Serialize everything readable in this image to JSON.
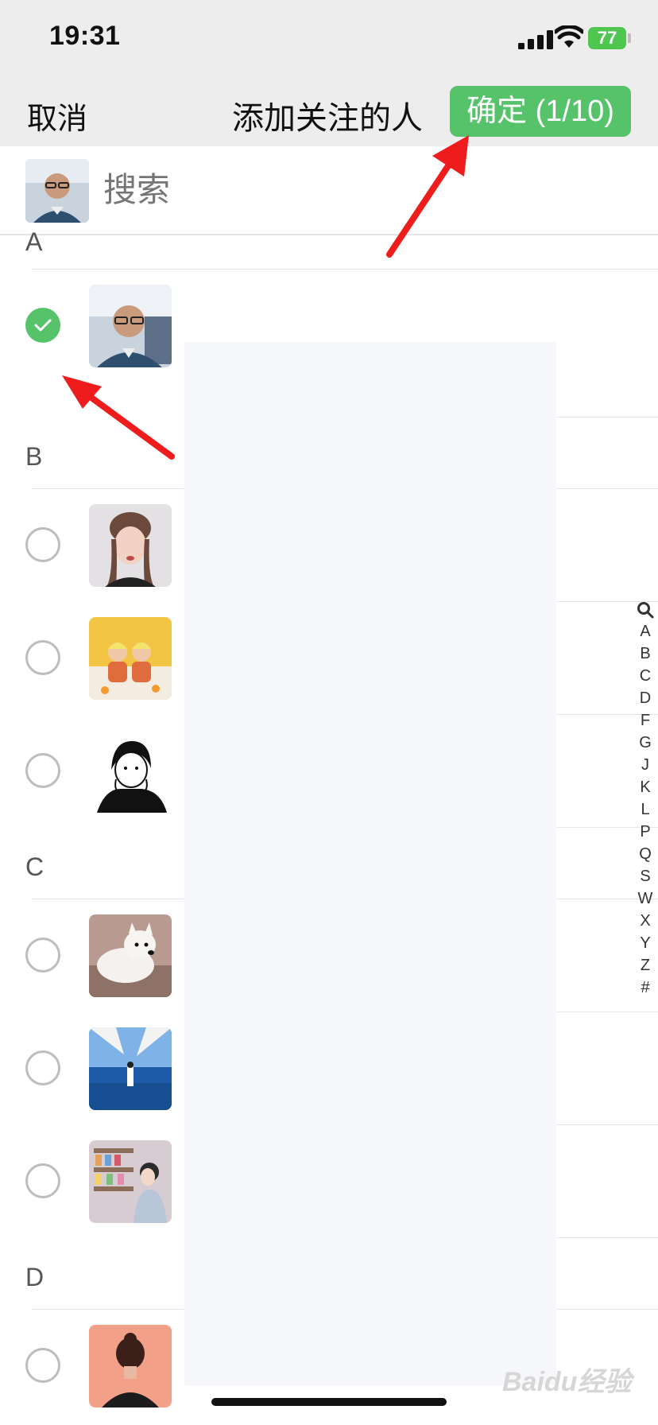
{
  "status_bar": {
    "time": "19:31",
    "battery": "77"
  },
  "nav": {
    "cancel_label": "取消",
    "title": "添加关注的人",
    "confirm_label": "确定 (1/10)"
  },
  "search": {
    "placeholder": "搜索"
  },
  "sections": [
    {
      "letter": "A",
      "items": [
        {
          "checked": true
        }
      ]
    },
    {
      "letter": "B",
      "items": [
        {
          "checked": false
        },
        {
          "checked": false
        },
        {
          "checked": false
        }
      ]
    },
    {
      "letter": "C",
      "items": [
        {
          "checked": false
        },
        {
          "checked": false
        },
        {
          "checked": false
        }
      ]
    },
    {
      "letter": "D",
      "items": [
        {
          "checked": false
        }
      ]
    }
  ],
  "index_bar": [
    "A",
    "B",
    "C",
    "D",
    "F",
    "G",
    "J",
    "K",
    "L",
    "P",
    "Q",
    "S",
    "W",
    "X",
    "Y",
    "Z",
    "#"
  ],
  "watermark": "Baidu经验",
  "colors": {
    "accent": "#56c26a",
    "nav_bg": "#ededed",
    "arrow": "#ee1c1c"
  }
}
